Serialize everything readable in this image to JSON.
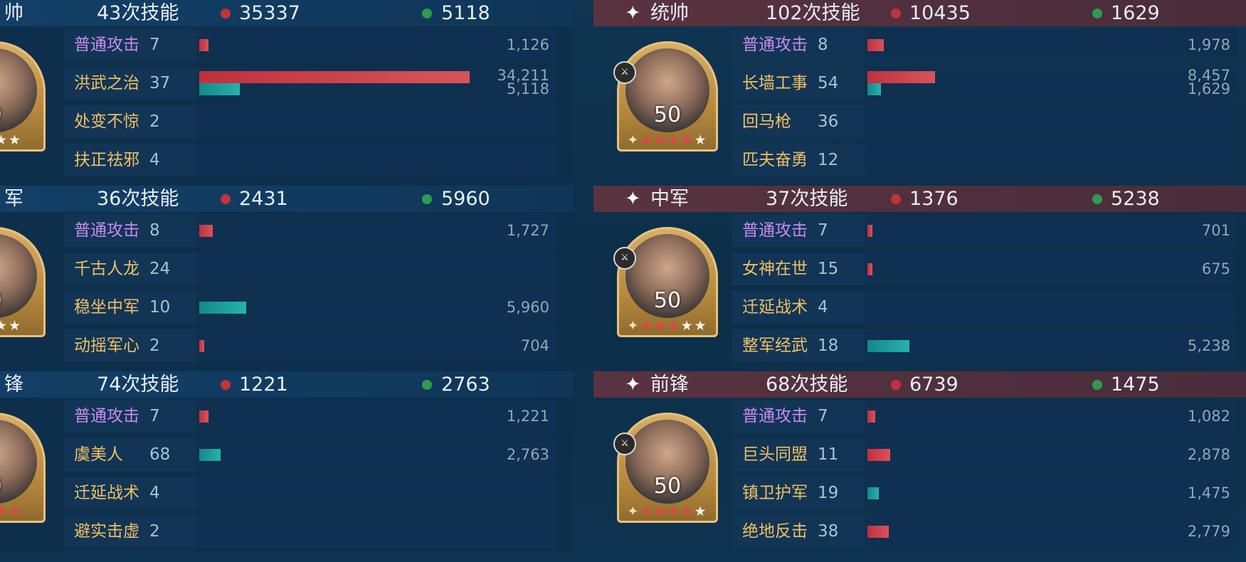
{
  "left": {
    "sections": [
      {
        "role": "帅",
        "skills_count": "43次技能",
        "damage": "35337",
        "heal": "5118",
        "level": "0",
        "stars": [
          "r",
          "r",
          "w",
          "w"
        ],
        "rows": [
          {
            "name": "普通攻击",
            "type": "basic",
            "count": "7",
            "bars": [
              {
                "color": "r",
                "frac": 0.033
              }
            ],
            "values": [
              "1,126"
            ]
          },
          {
            "name": "洪武之治",
            "type": "tac",
            "count": "37",
            "bars": [
              {
                "color": "r",
                "frac": 1.0
              },
              {
                "color": "t",
                "frac": 0.15
              }
            ],
            "values": [
              "34,211",
              "5,118"
            ]
          },
          {
            "name": "处变不惊",
            "type": "tac",
            "count": "2",
            "bars": [],
            "values": []
          },
          {
            "name": "扶正祛邪",
            "type": "tac",
            "count": "4",
            "bars": [],
            "values": []
          }
        ]
      },
      {
        "role": "军",
        "skills_count": "36次技能",
        "damage": "2431",
        "heal": "5960",
        "level": "0",
        "stars": [
          "w",
          "w",
          "w",
          "w"
        ],
        "rows": [
          {
            "name": "普通攻击",
            "type": "basic",
            "count": "8",
            "bars": [
              {
                "color": "r",
                "frac": 0.05
              }
            ],
            "values": [
              "1,727"
            ]
          },
          {
            "name": "千古人龙",
            "type": "tac",
            "count": "24",
            "bars": [],
            "values": []
          },
          {
            "name": "稳坐中军",
            "type": "tac",
            "count": "10",
            "bars": [
              {
                "color": "t",
                "frac": 0.174
              }
            ],
            "values": [
              "5,960"
            ]
          },
          {
            "name": "动摇军心",
            "type": "tac",
            "count": "2",
            "bars": [
              {
                "color": "r",
                "frac": 0.018
              }
            ],
            "values": [
              "704"
            ]
          }
        ]
      },
      {
        "role": "锋",
        "skills_count": "74次技能",
        "damage": "1221",
        "heal": "2763",
        "level": "0",
        "stars": [
          "r",
          "r",
          "r",
          "r"
        ],
        "rows": [
          {
            "name": "普通攻击",
            "type": "basic",
            "count": "7",
            "bars": [
              {
                "color": "r",
                "frac": 0.035
              }
            ],
            "values": [
              "1,221"
            ]
          },
          {
            "name": " 虞美人 ",
            "type": "tac",
            "count": "68",
            "bars": [
              {
                "color": "t",
                "frac": 0.08
              }
            ],
            "values": [
              "2,763"
            ]
          },
          {
            "name": "迁延战术",
            "type": "tac",
            "count": "4",
            "bars": [],
            "values": []
          },
          {
            "name": "避实击虚",
            "type": "tac",
            "count": "2",
            "bars": [],
            "values": []
          }
        ]
      }
    ]
  },
  "right": {
    "sections": [
      {
        "role": "统帅",
        "skills_count": "102次技能",
        "damage": "10435",
        "heal": "1629",
        "level": "50",
        "stars": [
          "g",
          "r",
          "r",
          "r",
          "r",
          "w"
        ],
        "rows": [
          {
            "name": "普通攻击",
            "type": "basic",
            "count": "8",
            "bars": [
              {
                "color": "r",
                "frac": 0.06
              }
            ],
            "values": [
              "1,978"
            ]
          },
          {
            "name": "长墙工事",
            "type": "tac",
            "count": "54",
            "bars": [
              {
                "color": "r",
                "frac": 0.25
              },
              {
                "color": "t",
                "frac": 0.05
              }
            ],
            "values": [
              "8,457",
              "1,629"
            ]
          },
          {
            "name": " 回马枪 ",
            "type": "tac",
            "count": "36",
            "bars": [],
            "values": []
          },
          {
            "name": "匹夫奋勇",
            "type": "tac",
            "count": "12",
            "bars": [],
            "values": []
          }
        ]
      },
      {
        "role": "中军",
        "skills_count": "37次技能",
        "damage": "1376",
        "heal": "5238",
        "level": "50",
        "stars": [
          "g",
          "r",
          "r",
          "r",
          "w",
          "w"
        ],
        "rows": [
          {
            "name": "普通攻击",
            "type": "basic",
            "count": "7",
            "bars": [
              {
                "color": "r",
                "frac": 0.018
              }
            ],
            "values": [
              "701"
            ]
          },
          {
            "name": "女神在世",
            "type": "tac",
            "count": "15",
            "bars": [
              {
                "color": "r",
                "frac": 0.018
              }
            ],
            "values": [
              "675"
            ]
          },
          {
            "name": "迁延战术",
            "type": "tac",
            "count": "4",
            "bars": [],
            "values": []
          },
          {
            "name": "整军经武",
            "type": "tac",
            "count": "18",
            "bars": [
              {
                "color": "t",
                "frac": 0.155
              }
            ],
            "values": [
              "5,238"
            ]
          }
        ]
      },
      {
        "role": "前锋",
        "skills_count": "68次技能",
        "damage": "6739",
        "heal": "1475",
        "level": "50",
        "stars": [
          "g",
          "r",
          "r",
          "r",
          "r",
          "w"
        ],
        "rows": [
          {
            "name": "普通攻击",
            "type": "basic",
            "count": "7",
            "bars": [
              {
                "color": "r",
                "frac": 0.03
              }
            ],
            "values": [
              "1,082"
            ]
          },
          {
            "name": "巨头同盟",
            "type": "tac",
            "count": "11",
            "bars": [
              {
                "color": "r",
                "frac": 0.083
              }
            ],
            "values": [
              "2,878"
            ]
          },
          {
            "name": "镇卫护军",
            "type": "tac",
            "count": "19",
            "bars": [
              {
                "color": "t",
                "frac": 0.042
              }
            ],
            "values": [
              "1,475"
            ]
          },
          {
            "name": "绝地反击",
            "type": "tac",
            "count": "38",
            "bars": [
              {
                "color": "r",
                "frac": 0.08
              }
            ],
            "values": [
              "2,779"
            ]
          }
        ]
      }
    ]
  }
}
